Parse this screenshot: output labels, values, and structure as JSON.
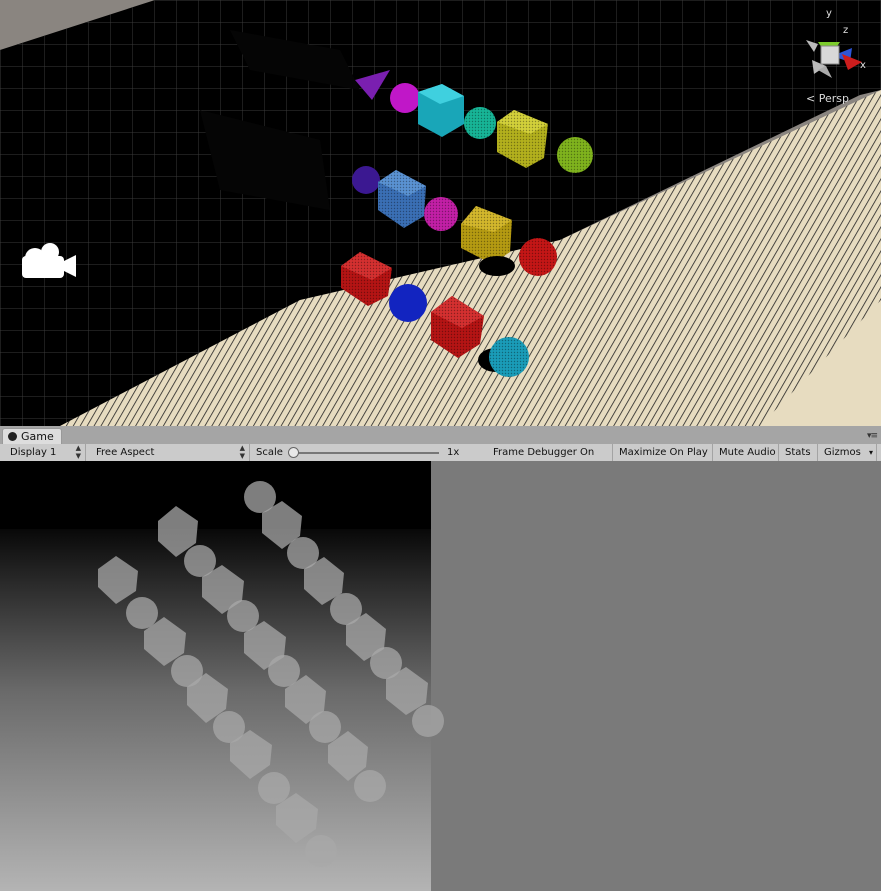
{
  "scene": {
    "perspective_label": "< Persp",
    "gizmo_axes": {
      "y": "y",
      "z": "z",
      "x": "x"
    },
    "icons": [
      "camera-icon",
      "scene-gizmo-icon"
    ]
  },
  "game_panel": {
    "tab_label": "Game",
    "toolbar": {
      "display": "Display 1",
      "aspect": "Free Aspect",
      "scale_label": "Scale",
      "scale_value": "1x",
      "frame_debugger": "Frame Debugger On",
      "maximize_on_play": "Maximize On Play",
      "mute_audio": "Mute Audio",
      "stats": "Stats",
      "gizmos": "Gizmos"
    }
  },
  "colors": {
    "ground": "#000000",
    "grid": "#3a3a3a",
    "plane": "#e7dcc0",
    "game_bg": "#7a7a7a"
  }
}
